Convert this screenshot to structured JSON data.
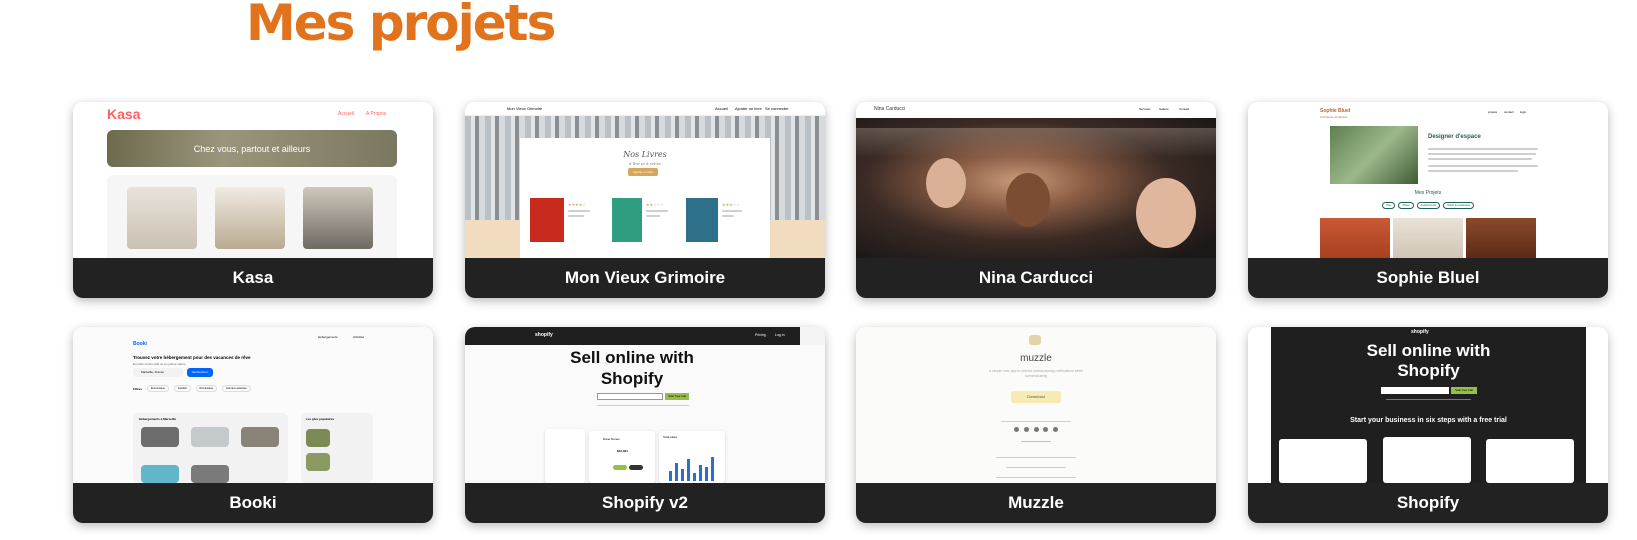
{
  "page_title": "Mes projets",
  "projects": [
    {
      "name": "Kasa",
      "logo": "Kasa",
      "nav": [
        "Accueil",
        "A Propos"
      ],
      "banner": "Chez vous, partout et ailleurs"
    },
    {
      "name": "Mon Vieux Grimoire",
      "site_name": "Mon Vieux Grimoire",
      "nav": [
        "Accueil",
        "Ajouter un livre",
        "Se connecter"
      ],
      "heading": "Nos Livres",
      "subheading": "à lire et à relire",
      "button": "Ajouter un livre",
      "books": [
        "Le Seigneur des Anneaux",
        "Les Secrets de l'Immobilier",
        "Sorrow and Bliss"
      ]
    },
    {
      "name": "Nina Carducci",
      "site_name": "Nina Carducci",
      "nav": [
        "Services",
        "Galerie",
        "Contact"
      ]
    },
    {
      "name": "Sophie Bluel",
      "site_name": "Sophie Bluel",
      "subtitle": "Architecte d'intérieur",
      "nav": [
        "projets",
        "contact",
        "login"
      ],
      "heading": "Designer d'espace",
      "section": "Mes Projets",
      "filters": [
        "Tous",
        "Objets",
        "Appartements",
        "Hôtels & restaurants"
      ]
    },
    {
      "name": "Booki",
      "logo": "Booki",
      "nav": [
        "Hébergements",
        "Activités"
      ],
      "headline": "Trouvez votre hébergement pour des vacances de rêve",
      "subline": "En plein centre-ville ou en pleine nature",
      "city": "Marseille, France",
      "search_button": "Rechercher",
      "filters_label": "Filtres",
      "filters": [
        "Économique",
        "Familial",
        "Romantique",
        "Animaux autorisés"
      ],
      "section_left": "Hébergements à Marseille",
      "section_right": "Les plus populaires"
    },
    {
      "name": "Shopify v2",
      "brand": "shopify",
      "nav": [
        "Pricing",
        "Log in"
      ],
      "headline": "Sell online with Shopify",
      "cta": "Start free trial",
      "owner": "Dane Nunes",
      "total": "$12,324",
      "stats_label": "Total sales"
    },
    {
      "name": "Muzzle",
      "brand": "muzzle",
      "tagline": "a simple mac app to silence embarrassing notifications while screensharing",
      "download": "Download"
    },
    {
      "name": "Shopify",
      "brand": "shopify",
      "headline": "Sell online with Shopify",
      "cta": "Start free trial",
      "subheadline": "Start your business in six steps with a free trial"
    }
  ],
  "colors": {
    "title": "#e0731c",
    "label_bg": "#222222",
    "kasa": "#ff6060",
    "grimoire": "#d6a75a",
    "booki": "#0065fc",
    "shopify_green": "#95bf47",
    "sophie": "#1d6154"
  }
}
